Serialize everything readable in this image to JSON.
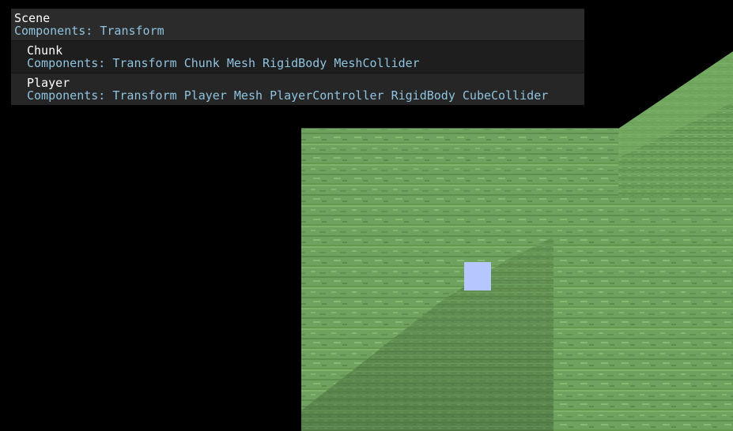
{
  "hierarchy": {
    "scene": {
      "name": "Scene",
      "components_label": "Components:",
      "components": [
        "Transform"
      ]
    },
    "children": [
      {
        "name": "Chunk",
        "components_label": "Components:",
        "components": [
          "Transform",
          "Chunk",
          "Mesh",
          "RigidBody",
          "MeshCollider"
        ]
      },
      {
        "name": "Player",
        "components_label": "Components:",
        "components": [
          "Transform",
          "Player",
          "Mesh",
          "PlayerController",
          "RigidBody",
          "CubeCollider"
        ]
      }
    ]
  },
  "viewport": {
    "background_color": "#000000",
    "terrain_color": "#6ea25e",
    "terrain_shade_color": "#5c8f4e",
    "terrain_light_color": "#7fb36b",
    "crosshair_color": "#b4c8ff"
  },
  "colors": {
    "node_name": "#ffffff",
    "components_text": "#8fc3df",
    "scene_row_bg": "#2b2b2b",
    "chunk_row_bg": "#1e1e1e",
    "player_row_bg": "#262626"
  }
}
